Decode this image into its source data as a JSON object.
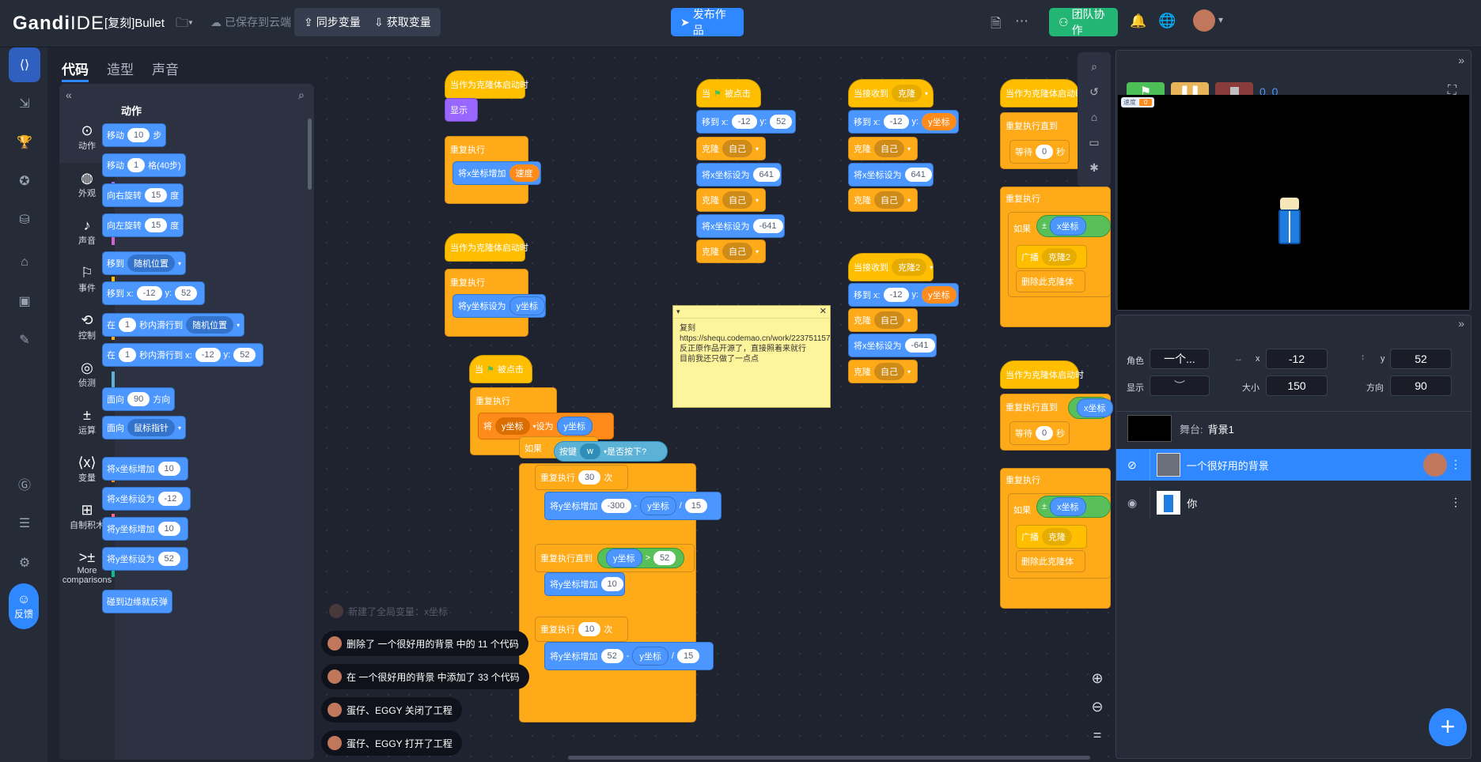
{
  "app": {
    "logo_bold": "Gandi",
    "logo_rest": " IDE",
    "project_title": "[复刻]Bullet"
  },
  "topbar": {
    "saved_label": "已保存到云端",
    "sync_vars_label": "同步变量",
    "fetch_vars_label": "获取变量",
    "publish_label": "发布作品",
    "team_label": "团队协作"
  },
  "tabs": [
    "代码",
    "造型",
    "声音"
  ],
  "categories": [
    {
      "label": "动作",
      "icon": "motion-icon",
      "color": "#4c97ff"
    },
    {
      "label": "外观",
      "icon": "looks-icon",
      "color": "#9966ff"
    },
    {
      "label": "声音",
      "icon": "sound-icon",
      "color": "#cf63cf"
    },
    {
      "label": "事件",
      "icon": "events-icon",
      "color": "#ffbf00"
    },
    {
      "label": "控制",
      "icon": "control-icon",
      "color": "#ffab19"
    },
    {
      "label": "侦测",
      "icon": "sensing-icon",
      "color": "#5cb1d6"
    },
    {
      "label": "运算",
      "icon": "operators-icon",
      "color": "#59c059"
    },
    {
      "label": "变量",
      "icon": "variables-icon",
      "color": "#ff8c1a"
    },
    {
      "label": "自制积木",
      "icon": "myblocks-icon",
      "color": "#ff6680"
    },
    {
      "label": "More",
      "label2": "comparisons",
      "icon": "comparisons-icon",
      "color": "#0fbd8c"
    }
  ],
  "palette": {
    "heading": "动作",
    "b1": {
      "a": "移动",
      "v": "10",
      "b": "步"
    },
    "b2": {
      "a": "移动",
      "v": "1",
      "b": "格(40步)"
    },
    "b3": {
      "a": "向右旋转",
      "v": "15",
      "b": "度"
    },
    "b4": {
      "a": "向左旋转",
      "v": "15",
      "b": "度"
    },
    "b5": {
      "a": "移到",
      "d": "随机位置"
    },
    "b6": {
      "a": "移到 x:",
      "v": "-12",
      "b": "y:",
      "v2": "52"
    },
    "b7": {
      "a": "在",
      "v": "1",
      "b": "秒内滑行到",
      "d": "随机位置"
    },
    "b8": {
      "a": "在",
      "v": "1",
      "b": "秒内滑行到 x:",
      "v2": "-12",
      "c": "y:",
      "v3": "52"
    },
    "b9": {
      "a": "面向",
      "v": "90",
      "b": "方向"
    },
    "b10": {
      "a": "面向",
      "d": "鼠标指针"
    },
    "b11": {
      "a": "将x坐标增加",
      "v": "10"
    },
    "b12": {
      "a": "将x坐标设为",
      "v": "-12"
    },
    "b13": {
      "a": "将y坐标增加",
      "v": "10"
    },
    "b14": {
      "a": "将y坐标设为",
      "v": "52"
    },
    "b15": {
      "a": "碰到边缘就反弹"
    }
  },
  "code": {
    "clone_start": "当作为克隆体启动时",
    "show": "显示",
    "forever": "重复执行",
    "change_x": "将x坐标增加",
    "set_y": "将y坐标设为",
    "speed_var": "速度",
    "y_coord": "y坐标",
    "x_coord": "x坐标",
    "green_flag_a": "当",
    "green_flag_b": "被点击",
    "goto_x": "移到 x:",
    "goto_y": "y:",
    "clone": "克隆",
    "self": "自己",
    "set_x": "将x坐标设为",
    "v_neg12": "-12",
    "v_52": "52",
    "v_641": "641",
    "v_neg641": "-641",
    "receive": "当接收到",
    "msg_clone": "克隆",
    "msg_clone2": "克隆2",
    "wait": "等待",
    "seconds": "秒",
    "v_0": "0",
    "forever_until": "重复执行直到",
    "if": "如果",
    "broadcast": "广播",
    "delete_clone": "删除此克隆体",
    "set_var": "将",
    "set_to": "设为",
    "y_var": "y坐标",
    "key": "按键",
    "key_w": "w",
    "pressed": "是否按下?",
    "repeat": "重复执行",
    "v_30": "30",
    "times": "次",
    "change_y": "将y坐标增加",
    "v_neg300": "-300",
    "minus": "-",
    "divide": "/",
    "v_15": "15",
    "gt": ">",
    "v_10": "10",
    "plus_minus": "±"
  },
  "comment": {
    "text1": "复刻",
    "text2": "https://shequ.codemao.cn/work/223751157",
    "text3": "反正原作品开源了，直接照着来就行",
    "text4": "目前我还只做了一点点"
  },
  "toasts": [
    "新建了全局变量：x坐标",
    "删除了 一个很好用的背景 中的 11 个代码",
    "在 一个很好用的背景 中添加了 33 个代码",
    "蛋仔、EGGY 关闭了工程",
    "蛋仔、EGGY 打开了工程"
  ],
  "stage": {
    "coords": "0, 0",
    "monitor_label": "速度",
    "monitor_value": "0"
  },
  "sprite": {
    "name_label": "角色",
    "name_value": "一个...",
    "x_label": "x",
    "x_value": "-12",
    "y_label": "y",
    "y_value": "52",
    "show_label": "显示",
    "size_label": "大小",
    "size_value": "150",
    "dir_label": "方向",
    "dir_value": "90",
    "stage_label": "舞台:",
    "stage_value": "背景1",
    "sprites": [
      "一个很好用的背景",
      "你"
    ]
  },
  "feedback_label": "反馈",
  "colors": {
    "accent": "#2f88ff",
    "team": "#22b573",
    "topbar": "#262b38",
    "workspace": "#1f2330"
  }
}
